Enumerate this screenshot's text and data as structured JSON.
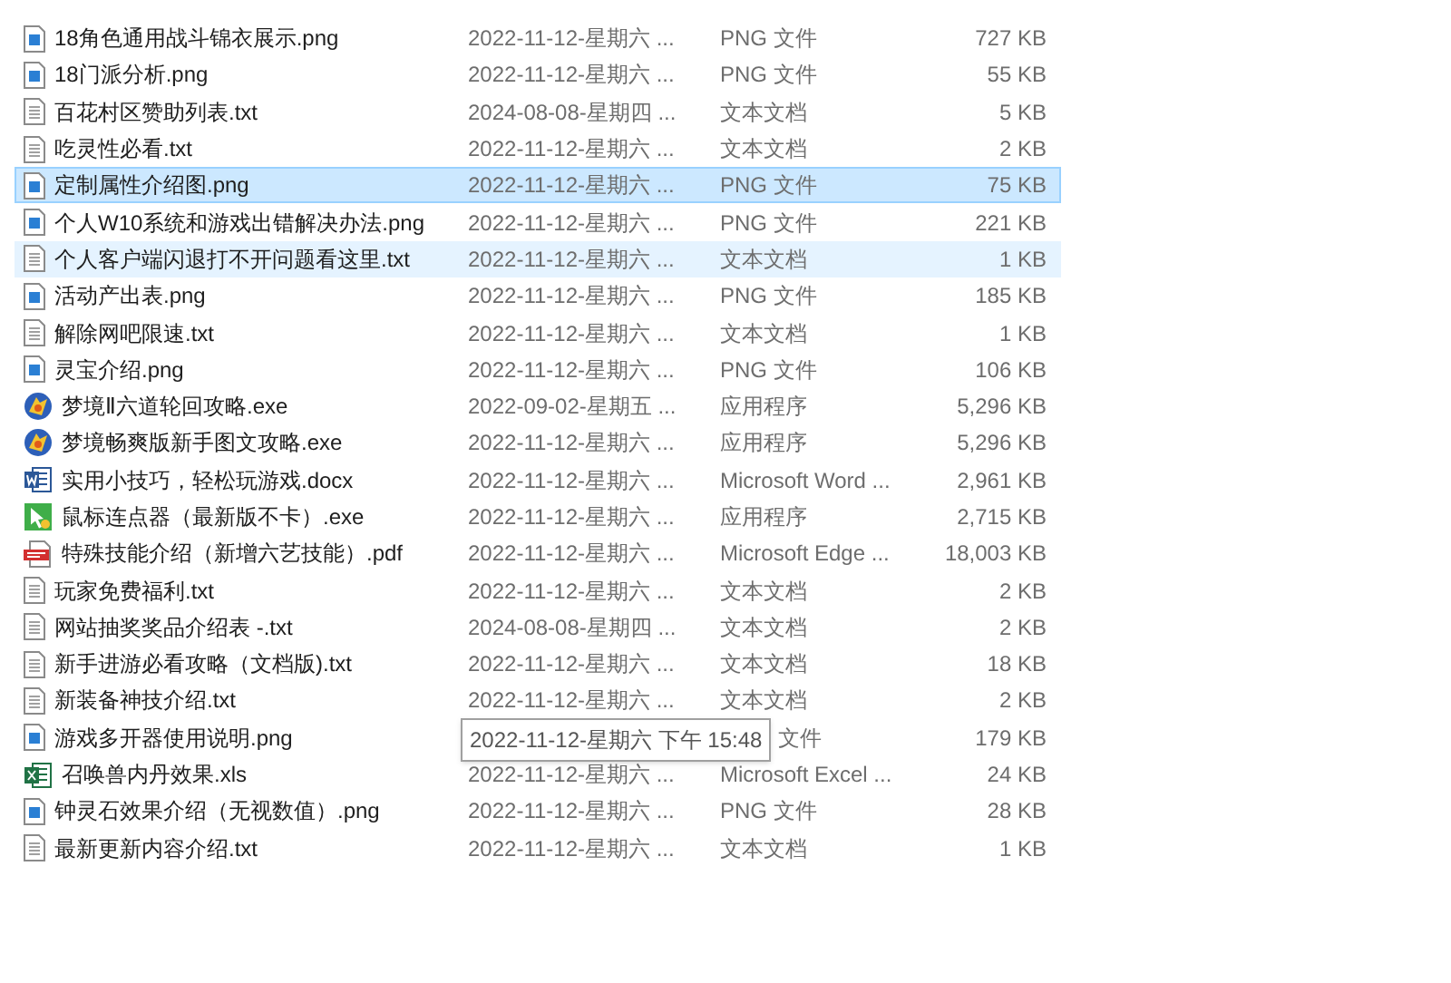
{
  "files": [
    {
      "name": "18角色通用战斗锦衣展示.png",
      "kind": "png",
      "date": "2022-11-12-星期六 ...",
      "type": "PNG 文件",
      "size": "727 KB",
      "selected": false,
      "hovered": false
    },
    {
      "name": "18门派分析.png",
      "kind": "png",
      "date": "2022-11-12-星期六 ...",
      "type": "PNG 文件",
      "size": "55 KB",
      "selected": false,
      "hovered": false
    },
    {
      "name": "百花村区赞助列表.txt",
      "kind": "txt",
      "date": "2024-08-08-星期四 ...",
      "type": "文本文档",
      "size": "5 KB",
      "selected": false,
      "hovered": false
    },
    {
      "name": "吃灵性必看.txt",
      "kind": "txt",
      "date": "2022-11-12-星期六 ...",
      "type": "文本文档",
      "size": "2 KB",
      "selected": false,
      "hovered": false
    },
    {
      "name": "定制属性介绍图.png",
      "kind": "png",
      "date": "2022-11-12-星期六 ...",
      "type": "PNG 文件",
      "size": "75 KB",
      "selected": true,
      "hovered": false
    },
    {
      "name": "个人W10系统和游戏出错解决办法.png",
      "kind": "png",
      "date": "2022-11-12-星期六 ...",
      "type": "PNG 文件",
      "size": "221 KB",
      "selected": false,
      "hovered": false
    },
    {
      "name": "个人客户端闪退打不开问题看这里.txt",
      "kind": "txt",
      "date": "2022-11-12-星期六 ...",
      "type": "文本文档",
      "size": "1 KB",
      "selected": false,
      "hovered": true
    },
    {
      "name": "活动产出表.png",
      "kind": "png",
      "date": "2022-11-12-星期六 ...",
      "type": "PNG 文件",
      "size": "185 KB",
      "selected": false,
      "hovered": false
    },
    {
      "name": "解除网吧限速.txt",
      "kind": "txt",
      "date": "2022-11-12-星期六 ...",
      "type": "文本文档",
      "size": "1 KB",
      "selected": false,
      "hovered": false
    },
    {
      "name": "灵宝介绍.png",
      "kind": "png",
      "date": "2022-11-12-星期六 ...",
      "type": "PNG 文件",
      "size": "106 KB",
      "selected": false,
      "hovered": false
    },
    {
      "name": "梦境Ⅱ六道轮回攻略.exe",
      "kind": "game",
      "date": "2022-09-02-星期五 ...",
      "type": "应用程序",
      "size": "5,296 KB",
      "selected": false,
      "hovered": false
    },
    {
      "name": "梦境畅爽版新手图文攻略.exe",
      "kind": "game",
      "date": "2022-11-12-星期六 ...",
      "type": "应用程序",
      "size": "5,296 KB",
      "selected": false,
      "hovered": false
    },
    {
      "name": "实用小技巧，轻松玩游戏.docx",
      "kind": "docx",
      "date": "2022-11-12-星期六 ...",
      "type": "Microsoft Word ...",
      "size": "2,961 KB",
      "selected": false,
      "hovered": false
    },
    {
      "name": "鼠标连点器（最新版不卡）.exe",
      "kind": "tool",
      "date": "2022-11-12-星期六 ...",
      "type": "应用程序",
      "size": "2,715 KB",
      "selected": false,
      "hovered": false
    },
    {
      "name": "特殊技能介绍（新增六艺技能）.pdf",
      "kind": "pdf",
      "date": "2022-11-12-星期六 ...",
      "type": "Microsoft Edge ...",
      "size": "18,003 KB",
      "selected": false,
      "hovered": false
    },
    {
      "name": "玩家免费福利.txt",
      "kind": "txt",
      "date": "2022-11-12-星期六 ...",
      "type": "文本文档",
      "size": "2 KB",
      "selected": false,
      "hovered": false
    },
    {
      "name": "网站抽奖奖品介绍表 -.txt",
      "kind": "txt",
      "date": "2024-08-08-星期四 ...",
      "type": "文本文档",
      "size": "2 KB",
      "selected": false,
      "hovered": false
    },
    {
      "name": "新手进游必看攻略（文档版).txt",
      "kind": "txt",
      "date": "2022-11-12-星期六 ...",
      "type": "文本文档",
      "size": "18 KB",
      "selected": false,
      "hovered": false
    },
    {
      "name": "新装备神技介绍.txt",
      "kind": "txt",
      "date": "2022-11-12-星期六 ...",
      "type": "文本文档",
      "size": "2 KB",
      "selected": false,
      "hovered": false
    },
    {
      "name": "游戏多开器使用说明.png",
      "kind": "png",
      "tooltip": "2022-11-12-星期六 下午 15:48",
      "type": "文件",
      "size": "179 KB",
      "selected": false,
      "hovered": false
    },
    {
      "name": "召唤兽内丹效果.xls",
      "kind": "xls",
      "date": "2022-11-12-星期六 ...",
      "type": "Microsoft Excel ...",
      "size": "24 KB",
      "selected": false,
      "hovered": false
    },
    {
      "name": "钟灵石效果介绍（无视数值）.png",
      "kind": "png",
      "date": "2022-11-12-星期六 ...",
      "type": "PNG 文件",
      "size": "28 KB",
      "selected": false,
      "hovered": false
    },
    {
      "name": "最新更新内容介绍.txt",
      "kind": "txt",
      "date": "2022-11-12-星期六 ...",
      "type": "文本文档",
      "size": "1 KB",
      "selected": false,
      "hovered": false
    }
  ]
}
